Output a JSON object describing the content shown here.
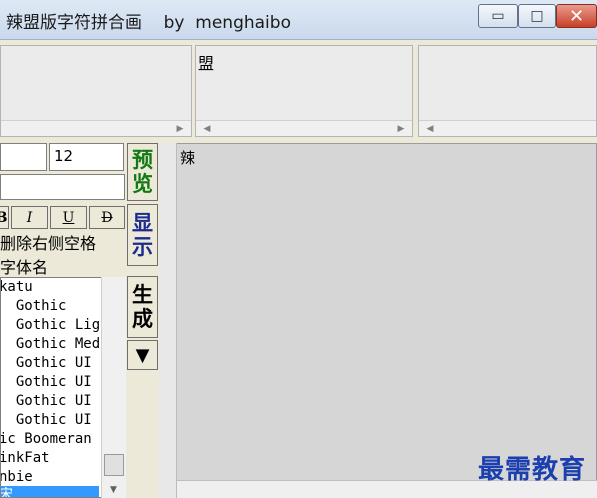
{
  "window": {
    "title": "辣盟版字符拼合画    by  menghaibo",
    "min_glyph": "▭",
    "max_glyph": "□",
    "close_glyph": "✕"
  },
  "top_panels": {
    "cell_2_text": "盟",
    "scroll_left": "◀",
    "scroll_right": "▶"
  },
  "controls": {
    "size_value": "12",
    "bold": "B",
    "italic": "I",
    "underline": "U",
    "strike": "D",
    "trim_label": "删除右侧空格",
    "fontname_label": "字体名"
  },
  "font_list": {
    "items": [
      "katu",
      "  Gothic",
      "  Gothic Lig",
      "  Gothic Med",
      "  Gothic UI",
      "  Gothic UI",
      "  Gothic UI",
      "  Gothic UI",
      "ic Boomeran",
      "inkFat",
      "nbie"
    ],
    "selected": "宋"
  },
  "buttons": {
    "preview": [
      "预",
      "览"
    ],
    "show": [
      "显",
      "示"
    ],
    "generate": [
      "生",
      "成"
    ],
    "dropdown": "▼"
  },
  "preview": {
    "text": "辣"
  },
  "watermark": "最需教育",
  "colors": {
    "preview_button": "#127a12",
    "show_button": "#1b2b8f",
    "watermark": "#1c3fb0",
    "selection": "#3399ff"
  }
}
